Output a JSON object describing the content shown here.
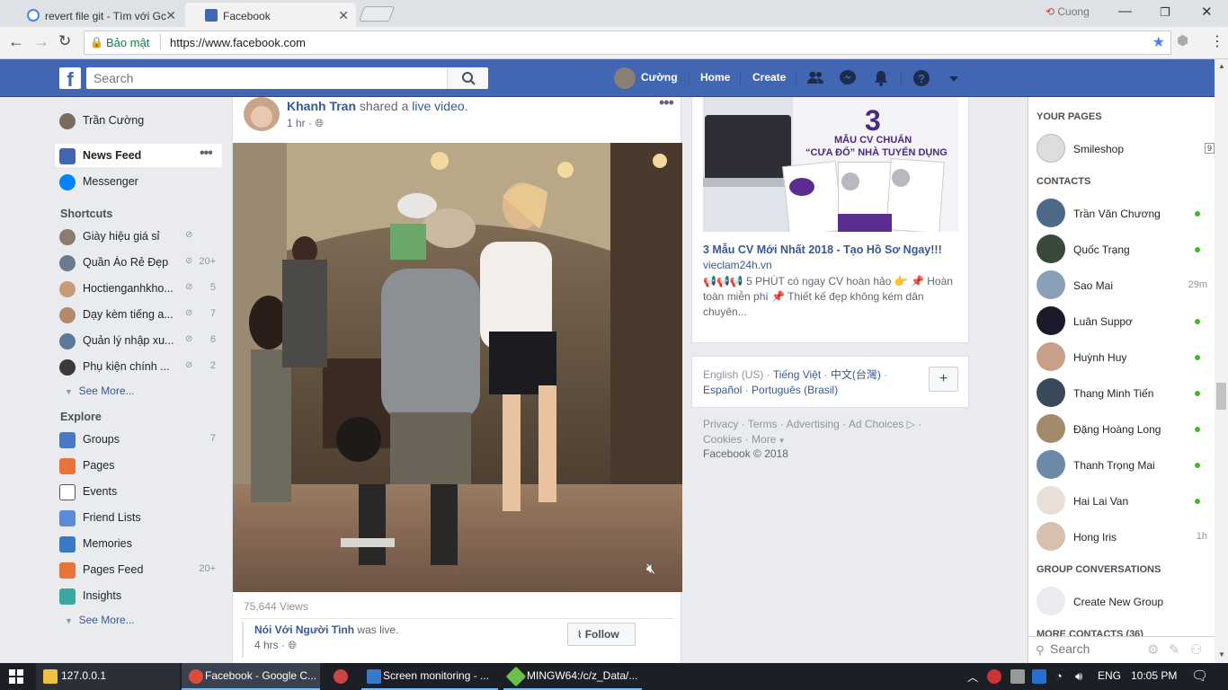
{
  "browser": {
    "tabs": [
      {
        "title": "revert file git - Tìm với Gc"
      },
      {
        "title": "Facebook"
      }
    ],
    "user": "Cuong",
    "secure_label": "Bảo mật",
    "url": "https://www.facebook.com"
  },
  "fb_header": {
    "search_placeholder": "Search",
    "profile_name": "Cường",
    "home": "Home",
    "create": "Create"
  },
  "left_nav": {
    "profile": "Trần Cường",
    "news_feed": "News Feed",
    "messenger": "Messenger",
    "shortcuts_title": "Shortcuts",
    "shortcuts": [
      {
        "label": "Giày hiệu giá sỉ",
        "count": ""
      },
      {
        "label": "Quần Áo Rẻ Đẹp",
        "count": "20+"
      },
      {
        "label": "Hoctienganhkho...",
        "count": "5"
      },
      {
        "label": "Dạy kèm tiếng a...",
        "count": "7"
      },
      {
        "label": "Quản lý nhập xu...",
        "count": "6"
      },
      {
        "label": "Phụ kiện chính ...",
        "count": "2"
      }
    ],
    "see_more": "See More...",
    "explore_title": "Explore",
    "explore": [
      {
        "label": "Groups",
        "count": "7",
        "icon": "groups-icon"
      },
      {
        "label": "Pages",
        "count": "",
        "icon": "flag-icon"
      },
      {
        "label": "Events",
        "count": "",
        "icon": "calendar-icon"
      },
      {
        "label": "Friend Lists",
        "count": "",
        "icon": "friend-list-icon"
      },
      {
        "label": "Memories",
        "count": "",
        "icon": "clock-icon"
      },
      {
        "label": "Pages Feed",
        "count": "20+",
        "icon": "pages-feed-icon"
      },
      {
        "label": "Insights",
        "count": "",
        "icon": "cube-icon"
      }
    ],
    "see_more_2": "See More..."
  },
  "post": {
    "author": "Khanh Tran",
    "action": "shared a",
    "link": "live video.",
    "time": "1 hr",
    "views": "75,644 Views",
    "shared_page": "Nói Với Người Tình",
    "shared_action": "was live.",
    "shared_time": "4 hrs",
    "follow": "Follow"
  },
  "ad": {
    "image_number": "3",
    "image_line1": "MẪU CV CHUẨN",
    "image_line2": "“CƯA ĐỔ” NHÀ TUYỂN DỤNG",
    "title": "3 Mẫu CV Mới Nhất 2018 - Tạo Hồ Sơ Ngay!!!",
    "domain": "vieclam24h.vn",
    "body": "📢📢📢 5 PHÚT có ngay CV hoàn hảo 👉 📌 Hoàn toàn miễn phí 📌 Thiết kế đẹp không kém dân chuyên..."
  },
  "languages": {
    "current": "English (US)",
    "others": [
      "Tiếng Việt",
      "中文(台灣)",
      "Español",
      "Português (Brasil)"
    ],
    "add": "+"
  },
  "footer": {
    "links": [
      "Privacy",
      "Terms",
      "Advertising",
      "Ad Choices",
      "Cookies",
      "More"
    ],
    "copyright": "Facebook © 2018"
  },
  "chat": {
    "your_pages_title": "YOUR PAGES",
    "page_name": "Smileshop",
    "page_badge": "9",
    "contacts_title": "CONTACTS",
    "contacts": [
      {
        "name": "Trần Văn Chương",
        "status": "online",
        "time": ""
      },
      {
        "name": "Quốc Trạng",
        "status": "online",
        "time": ""
      },
      {
        "name": "Sao Mai",
        "status": "idle",
        "time": "29m"
      },
      {
        "name": "Luân Suppơ",
        "status": "online",
        "time": ""
      },
      {
        "name": "Huỳnh Huy",
        "status": "online",
        "time": ""
      },
      {
        "name": "Thang Minh Tiến",
        "status": "online",
        "time": ""
      },
      {
        "name": "Đặng Hoàng Long",
        "status": "online",
        "time": ""
      },
      {
        "name": "Thanh Trọng Mai",
        "status": "online",
        "time": ""
      },
      {
        "name": "Hai Lai Van",
        "status": "online",
        "time": ""
      },
      {
        "name": "Hong Iris",
        "status": "idle",
        "time": "1h"
      }
    ],
    "group_conv_title": "GROUP CONVERSATIONS",
    "create_group": "Create New Group",
    "more_contacts": "MORE CONTACTS (36)",
    "search_placeholder": "Search"
  },
  "taskbar": {
    "items": [
      "127.0.0.1",
      "Facebook - Google C...",
      "",
      "Screen monitoring - ...",
      "MINGW64:/c/z_Data/..."
    ],
    "lang": "ENG",
    "time": "10:05 PM"
  },
  "colors": {
    "fb_blue": "#4267b2",
    "link": "#365899",
    "online": "#42b72a"
  }
}
